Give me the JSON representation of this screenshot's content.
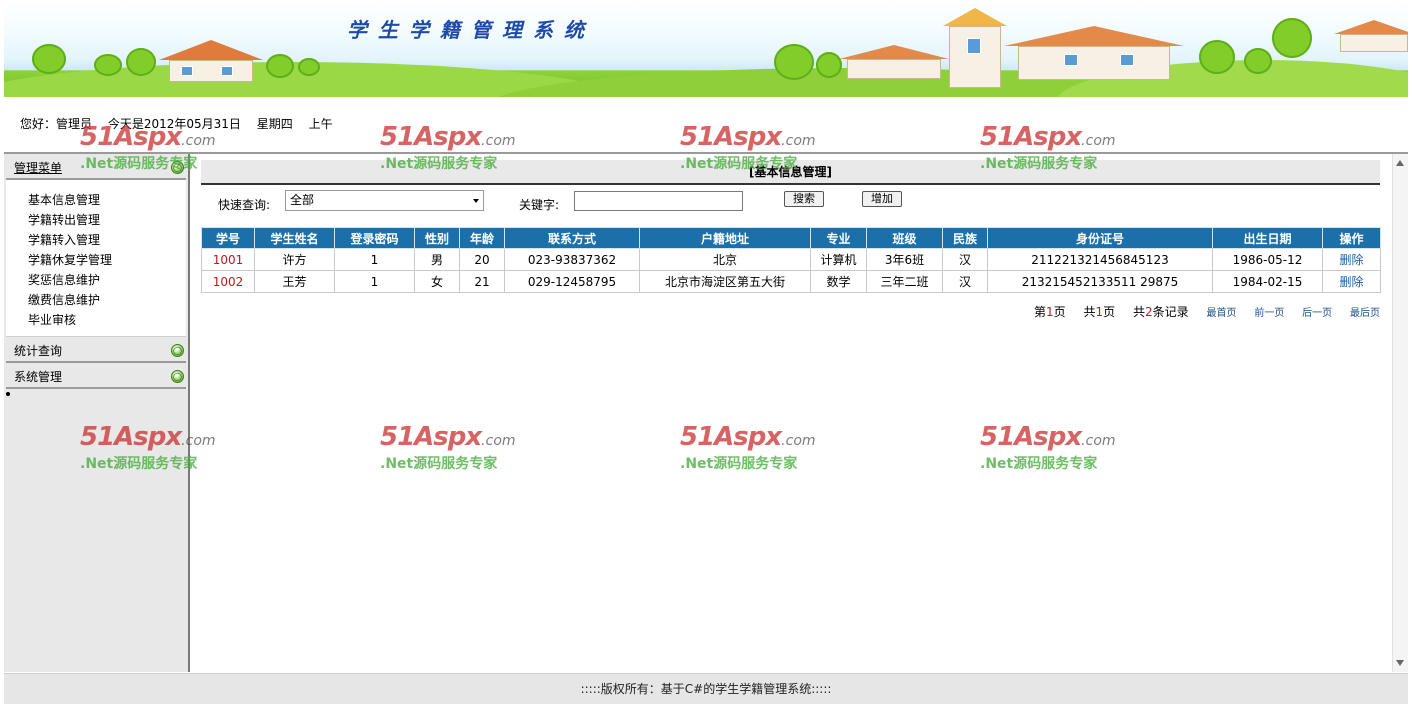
{
  "header": {
    "title": "学生学籍管理系统"
  },
  "greeting": {
    "user": "您好：管理员",
    "date": "今天是2012年05月31日",
    "weekday": "星期四",
    "period": "上午"
  },
  "sidebar": {
    "menu_title": "管理菜单",
    "items": [
      "基本信息管理",
      "学籍转出管理",
      "学籍转入管理",
      "学籍休复学管理",
      "奖惩信息维护",
      "缴费信息维护",
      "毕业审核"
    ],
    "sections": [
      "统计查询",
      "系统管理"
    ]
  },
  "main": {
    "section_title": "[基本信息管理]",
    "search": {
      "quick_label": "快速查询:",
      "quick_value": "全部",
      "keyword_label": "关键字:",
      "keyword_value": "",
      "search_button": "搜索",
      "add_button": "增加"
    },
    "table": {
      "headers": [
        "学号",
        "学生姓名",
        "登录密码",
        "性别",
        "年龄",
        "联系方式",
        "户籍地址",
        "专业",
        "班级",
        "民族",
        "身份证号",
        "出生日期",
        "操作"
      ],
      "rows": [
        [
          "1001",
          "许方",
          "1",
          "男",
          "20",
          "023-93837362",
          "北京",
          "计算机",
          "3年6班",
          "汉",
          "211221321456845123",
          "1986-05-12",
          "删除"
        ],
        [
          "1002",
          "王芳",
          "1",
          "女",
          "21",
          "029-12458795",
          "北京市海淀区第五大街",
          "数学",
          "三年二班",
          "汉",
          "213215452133511 29875",
          "1984-02-15",
          "删除"
        ]
      ]
    },
    "pager": {
      "page_prefix": "第",
      "page_current": "1",
      "page_suffix": "页",
      "total_prefix": "共",
      "total_pages": "1",
      "total_suffix": "页",
      "records_prefix": "共",
      "records_count": "2",
      "records_suffix": "条记录",
      "first": "最首页",
      "prev": "前一页",
      "next": "后一页",
      "last": "最后页"
    }
  },
  "footer": {
    "text": ":::::版权所有：基于C#的学生学籍管理系统:::::"
  },
  "watermark": {
    "logo": "51Aspx",
    "logo_suffix": ".com",
    "slogan": ".Net源码服务专家"
  },
  "colors": {
    "table_header": "#1b70aa",
    "id_text": "#c0181e",
    "link": "#1b5fa3",
    "sidebar_bg": "#e8e8e8"
  }
}
